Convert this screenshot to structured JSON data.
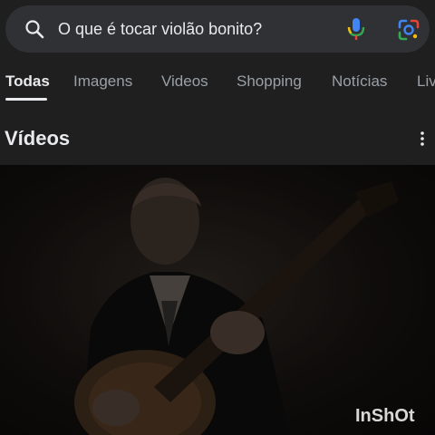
{
  "search": {
    "query": "O que é tocar violão bonito?"
  },
  "icons": {
    "search": "search-icon",
    "mic": "microphone-icon",
    "lens": "google-lens-icon",
    "more": "more-vert-icon"
  },
  "tabs": [
    {
      "label": "Todas",
      "active": true
    },
    {
      "label": "Imagens"
    },
    {
      "label": "Videos"
    },
    {
      "label": "Shopping"
    },
    {
      "label": "Notícias"
    },
    {
      "label": "Liv"
    }
  ],
  "section": {
    "title": "Vídeos"
  },
  "video": {
    "watermark": "InShOt"
  },
  "colors": {
    "background": "#1f1f1f",
    "search_bg": "#303134",
    "text": "#e8eaed",
    "muted": "#9aa0a6"
  }
}
